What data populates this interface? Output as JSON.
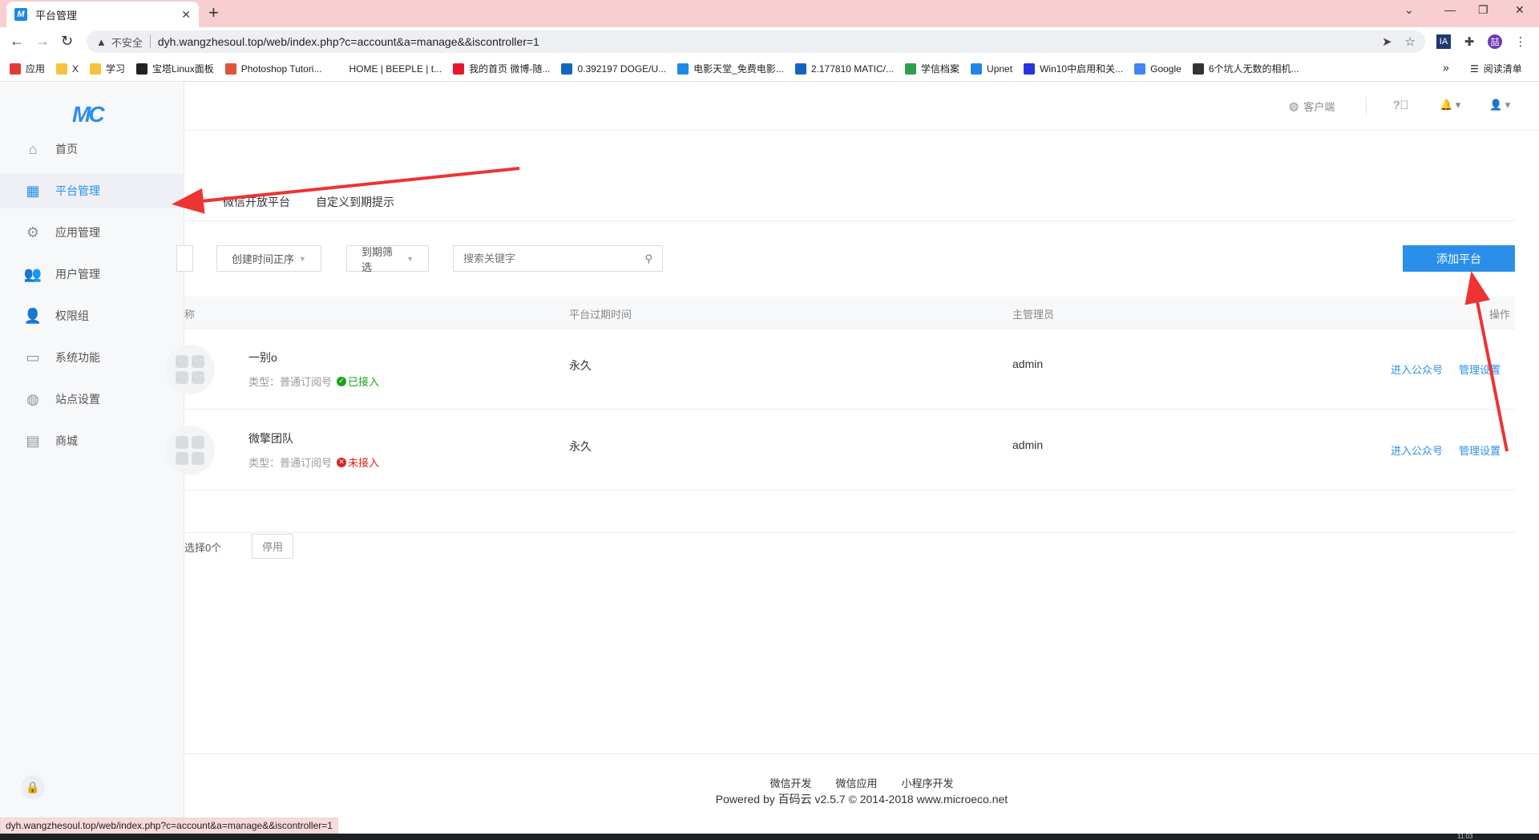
{
  "browser": {
    "tab_title": "平台管理",
    "tab_favicon": "M",
    "new_tab": "+",
    "insecure_label": "不安全",
    "url": "dyh.wangzhesoul.top/web/index.php?c=account&a=manage&&iscontroller=1",
    "profile_initial": "喆",
    "ext_ia": "IA",
    "bookmarks": [
      {
        "label": "应用",
        "icon": "apps-grid-icon",
        "color": "#e53935"
      },
      {
        "label": "X",
        "icon": "folder-icon",
        "color": "#f6c33d"
      },
      {
        "label": "学习",
        "icon": "folder-icon",
        "color": "#f6c33d"
      },
      {
        "label": "宝塔Linux面板",
        "icon": "bt-icon",
        "color": "#222222"
      },
      {
        "label": "Photoshop Tutori...",
        "icon": "photoshop-icon",
        "color": "#e0523c"
      },
      {
        "label": "HOME | BEEPLE | t...",
        "icon": "blank-icon",
        "color": "#ffffff"
      },
      {
        "label": "我的首页 微博-随...",
        "icon": "weibo-icon",
        "color": "#e6162d"
      },
      {
        "label": "0.392197 DOGE/U...",
        "icon": "flame-icon",
        "color": "#1565c0"
      },
      {
        "label": "电影天堂_免费电影...",
        "icon": "movie-icon",
        "color": "#1e88e5"
      },
      {
        "label": "2.177810 MATIC/...",
        "icon": "flame-icon",
        "color": "#1565c0"
      },
      {
        "label": "学信档案",
        "icon": "chsi-icon",
        "color": "#2e9e4f"
      },
      {
        "label": "Upnet",
        "icon": "upnet-icon",
        "color": "#1e88e5"
      },
      {
        "label": "Win10中启用和关...",
        "icon": "baidu-icon",
        "color": "#2932e1"
      },
      {
        "label": "Google",
        "icon": "google-icon",
        "color": "#4285f4"
      },
      {
        "label": "6个坑人无数的相机...",
        "icon": "camera-icon",
        "color": "#333333"
      }
    ],
    "bookmarks_more": "»",
    "reading_list": "阅读清单",
    "status_url": "dyh.wangzhesoul.top/web/index.php?c=account&a=manage&&iscontroller=1",
    "taskbar_time": "11:03"
  },
  "sidebar": {
    "logo": "MC",
    "items": [
      {
        "label": "首页",
        "icon": "home-icon",
        "glyph": "⌂"
      },
      {
        "label": "平台管理",
        "icon": "platform-grid-icon",
        "glyph": "▦"
      },
      {
        "label": "应用管理",
        "icon": "app-gear-icon",
        "glyph": "⚙"
      },
      {
        "label": "用户管理",
        "icon": "users-icon",
        "glyph": "👥"
      },
      {
        "label": "权限组",
        "icon": "user-lock-icon",
        "glyph": "👤"
      },
      {
        "label": "系统功能",
        "icon": "monitor-icon",
        "glyph": "▭"
      },
      {
        "label": "站点设置",
        "icon": "globe-icon",
        "glyph": "◍"
      },
      {
        "label": "商城",
        "icon": "store-icon",
        "glyph": "▤"
      }
    ],
    "active_index": 1
  },
  "header": {
    "client_label": "客户端"
  },
  "subtabs": [
    "微信开放平台",
    "自定义到期提示"
  ],
  "filters": {
    "sort_label": "创建时间正序",
    "expire_label": "到期筛选",
    "search_placeholder": "搜索关键字",
    "add_button": "添加平台"
  },
  "table": {
    "columns": [
      "称",
      "平台过期时间",
      "主管理员",
      "操作"
    ],
    "type_prefix": "类型：",
    "rows": [
      {
        "name": "一别o",
        "type": "普通订阅号",
        "status": "已接入",
        "status_ok": true,
        "expire": "永久",
        "admin": "admin",
        "action_enter": "进入公众号",
        "action_manage": "管理设置"
      },
      {
        "name": "微擎团队",
        "type": "普通订阅号",
        "status": "未接入",
        "status_ok": false,
        "expire": "永久",
        "admin": "admin",
        "action_enter": "进入公众号",
        "action_manage": "管理设置"
      }
    ]
  },
  "bulk": {
    "selected_text": "选择0个",
    "disable_button": "停用"
  },
  "footer": {
    "links": [
      "微信开发",
      "微信应用",
      "小程序开发"
    ],
    "copyright": "Powered by 百码云 v2.5.7 © 2014-2018 www.microeco.net"
  },
  "colors": {
    "accent": "#2b8fea",
    "ok": "#1aa31a",
    "error": "#e02020",
    "annotation_arrow": "#ee3333",
    "tabstrip": "#f7cfd0"
  }
}
